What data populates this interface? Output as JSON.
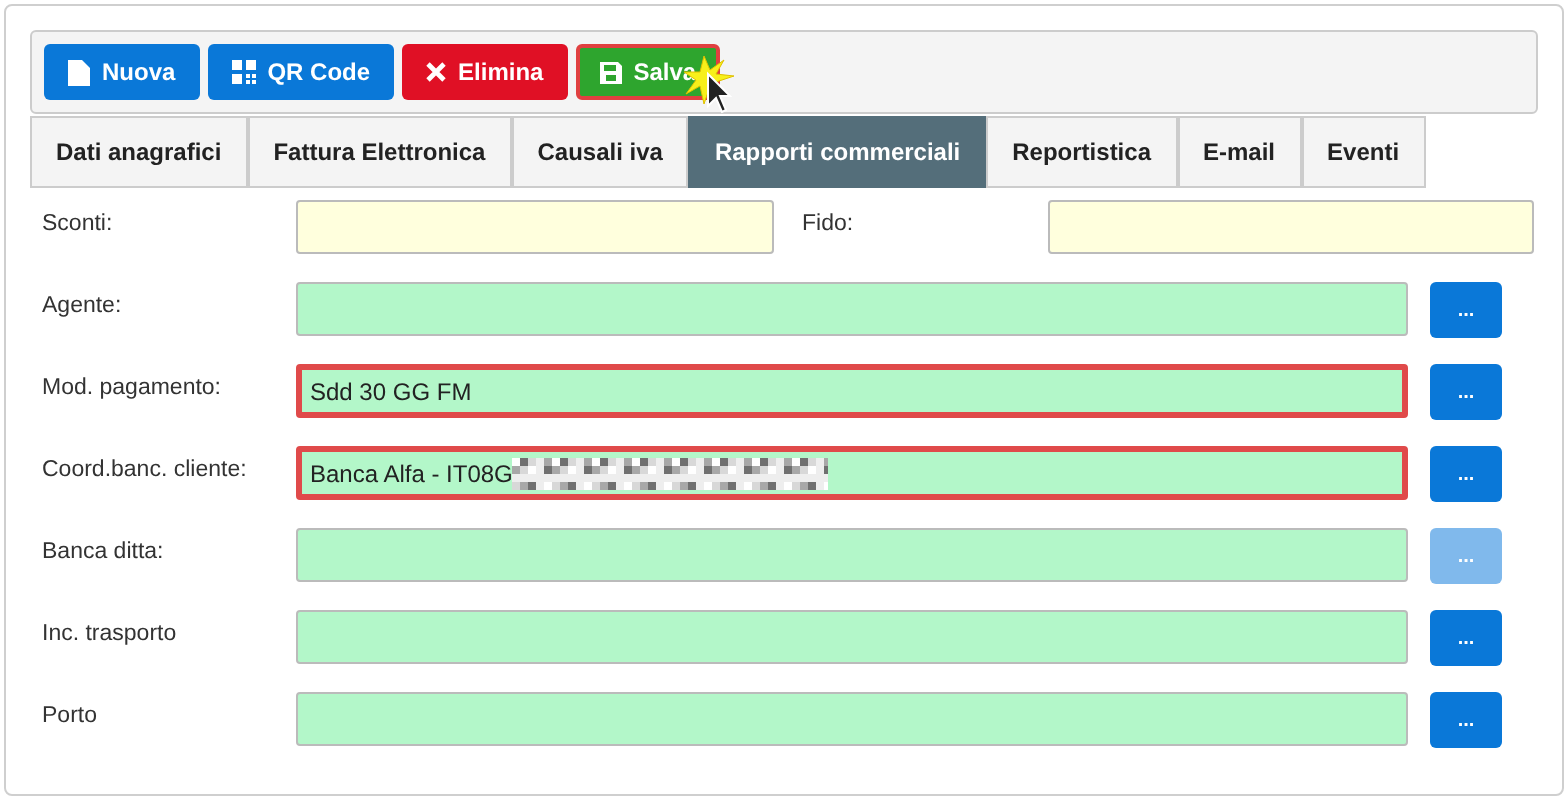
{
  "toolbar": [
    {
      "label": "Nuova",
      "kind": "new",
      "highlighted": false
    },
    {
      "label": "QR Code",
      "kind": "qr",
      "highlighted": false
    },
    {
      "label": "Elimina",
      "kind": "delete",
      "highlighted": false
    },
    {
      "label": "Salva",
      "kind": "save",
      "highlighted": true
    }
  ],
  "tabs": [
    {
      "label": "Dati anagrafici",
      "selected": false
    },
    {
      "label": "Fattura Elettronica",
      "selected": false
    },
    {
      "label": "Causali iva",
      "selected": false
    },
    {
      "label": "Rapporti commerciali",
      "selected": true
    },
    {
      "label": "Reportistica",
      "selected": false
    },
    {
      "label": "E-mail",
      "selected": false
    },
    {
      "label": "Eventi",
      "selected": false
    }
  ],
  "top_fields": [
    {
      "label": "Sconti:"
    },
    {
      "label": "Fido:"
    }
  ],
  "fields": [
    {
      "label": "Agente:",
      "highlighted": false,
      "button": {
        "label": "...",
        "disabled": false
      }
    },
    {
      "label": "Mod. pagamento:",
      "value": "Sdd 30 GG FM",
      "highlighted": true,
      "button": {
        "label": "...",
        "disabled": false
      }
    },
    {
      "label": "Coord.banc. cliente:",
      "value": "Banca Alfa - IT08G",
      "redacted": true,
      "highlighted": true,
      "button": {
        "label": "...",
        "disabled": false
      }
    },
    {
      "label": "Banca ditta:",
      "highlighted": false,
      "button": {
        "label": "...",
        "disabled": true
      }
    },
    {
      "label": "Inc. trasporto",
      "highlighted": false,
      "button": {
        "label": "...",
        "disabled": false
      }
    },
    {
      "label": "Porto",
      "highlighted": false,
      "button": {
        "label": "...",
        "disabled": false
      }
    }
  ]
}
